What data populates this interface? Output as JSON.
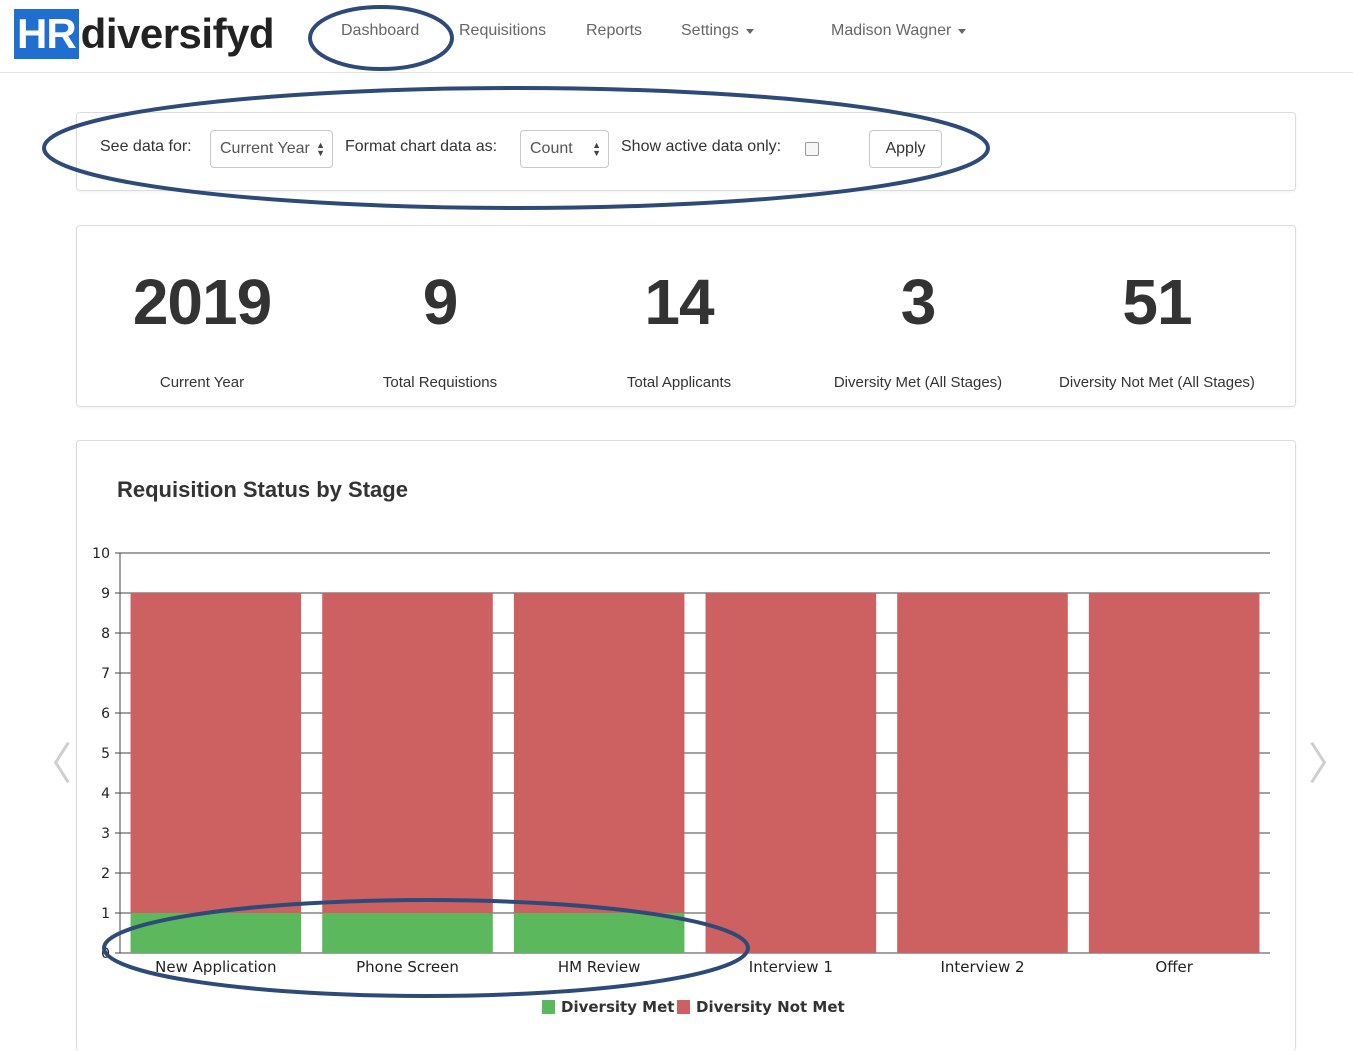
{
  "brand": {
    "logo_hr": "HR",
    "logo_rest": "diversifyd"
  },
  "nav": {
    "items": [
      {
        "label": "Dashboard"
      },
      {
        "label": "Requisitions"
      },
      {
        "label": "Reports"
      },
      {
        "label": "Settings"
      }
    ],
    "user": "Madison Wagner"
  },
  "filters": {
    "see_data_label": "See data for:",
    "see_data_value": "Current Year",
    "format_label": "Format chart data as:",
    "format_value": "Count",
    "active_label": "Show active data only:",
    "active_checked": false,
    "apply_label": "Apply"
  },
  "stats": [
    {
      "value": "2019",
      "label": "Current Year"
    },
    {
      "value": "9",
      "label": "Total Requistions"
    },
    {
      "value": "14",
      "label": "Total Applicants"
    },
    {
      "value": "3",
      "label": "Diversity Met (All Stages)"
    },
    {
      "value": "51",
      "label": "Diversity Not Met (All Stages)"
    }
  ],
  "carousel": {
    "prev_icon": "chevron-left-icon",
    "next_icon": "chevron-right-icon"
  },
  "colors": {
    "met": "#5cb85c",
    "not_met": "#cd6060",
    "annotation": "#2e4a78",
    "logo_blue": "#1f6fd0"
  },
  "chart_data": {
    "type": "bar",
    "stacked": true,
    "title": "Requisition Status by Stage",
    "categories": [
      "New Application",
      "Phone Screen",
      "HM Review",
      "Interview 1",
      "Interview 2",
      "Offer"
    ],
    "series": [
      {
        "name": "Diversity Met",
        "values": [
          1,
          1,
          1,
          0,
          0,
          0
        ]
      },
      {
        "name": "Diversity Not Met",
        "values": [
          8,
          8,
          8,
          9,
          9,
          9
        ]
      }
    ],
    "ylim": [
      0,
      10
    ],
    "yticks": [
      "0",
      "1",
      "2",
      "3",
      "4",
      "5",
      "6",
      "7",
      "8",
      "9",
      "10"
    ],
    "grid": true,
    "legend": "bottom-center"
  }
}
